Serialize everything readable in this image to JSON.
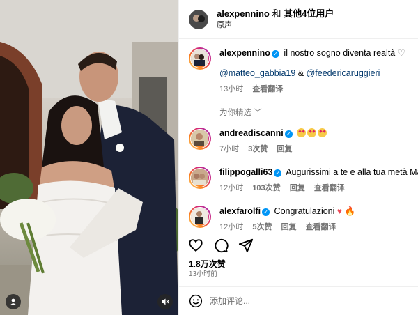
{
  "photo": {
    "user_tag_icon": "person-icon",
    "mute_icon": "muted-speaker-icon"
  },
  "header": {
    "username": "alexpennino",
    "connector": "和",
    "others": "其他4位用户",
    "audio": "原声"
  },
  "caption": {
    "username": "alexpennino",
    "text": "il nostro sogno diventa realtà",
    "mention1": "@matteo_gabbia19",
    "amp": "&",
    "mention2": "@feedericaruggieri",
    "time": "13小时",
    "translate": "查看翻译"
  },
  "section_label": "为你精选",
  "comments": [
    {
      "username": "andreadiscanni",
      "time": "7小时",
      "likes": "3次赞",
      "reply": "回复"
    },
    {
      "username": "filippogalli63",
      "text": "Augurissimi a te e alla tua metà Matte",
      "time": "12小时",
      "likes": "103次赞",
      "reply": "回复",
      "translate": "查看翻译"
    },
    {
      "username": "alexfarolfi",
      "text": "Congratulazioni",
      "time": "12小时",
      "likes": "5次赞",
      "reply": "回复",
      "translate": "查看翻译"
    }
  ],
  "actions": {
    "like_icon": "heart-icon",
    "comment_icon": "comment-bubble-icon",
    "share_icon": "paper-plane-icon"
  },
  "likes": "1.8万次赞",
  "posted": "13小时前",
  "compose": {
    "emoji_icon": "smiley-icon",
    "placeholder": "添加评论..."
  },
  "colors": {
    "verified": "#0095f6",
    "mention": "#00376b",
    "muted_text": "#737373",
    "heart_red": "#ed4956"
  }
}
